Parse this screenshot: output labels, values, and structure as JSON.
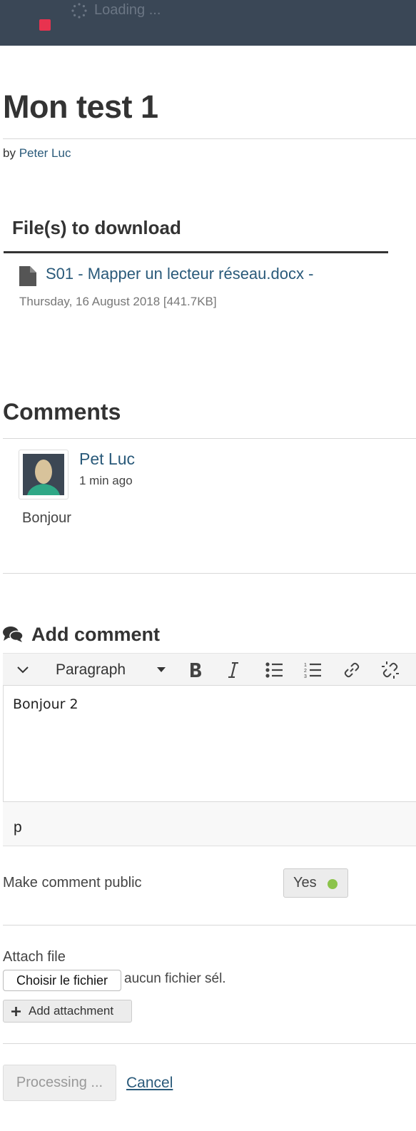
{
  "topbar": {
    "loading_text": "Loading ..."
  },
  "post": {
    "title": "Mon test 1",
    "by_prefix": "by",
    "author": "Peter Luc"
  },
  "files": {
    "section_title": "File(s) to download",
    "items": [
      {
        "name": "S01 - Mapper un lecteur réseau.docx -",
        "meta": "Thursday, 16 August 2018 [441.7KB]"
      }
    ]
  },
  "comments": {
    "section_title": "Comments",
    "items": [
      {
        "author": "Pet Luc",
        "time": "1 min ago",
        "body": "Bonjour"
      }
    ]
  },
  "add_comment": {
    "title": "Add comment",
    "toolbar": {
      "format_label": "Paragraph"
    },
    "editor_value": "Bonjour 2",
    "status_path": "p",
    "public_label": "Make comment public",
    "public_toggle_label": "Yes",
    "attach_label": "Attach file",
    "choose_file_label": "Choisir le fichier",
    "no_file_text": "aucun fichier sél.",
    "add_attachment_label": "Add attachment",
    "submit_label": "Processing ...",
    "cancel_label": "Cancel"
  },
  "colors": {
    "topbar": "#3a4756",
    "link": "#2a5a7a",
    "toggle_on": "#8bc34a"
  },
  "icons": [
    "spinner-icon",
    "file-icon",
    "comments-icon",
    "chevron-down-icon",
    "caret-down-icon",
    "bold-icon",
    "italic-icon",
    "bullet-list-icon",
    "numbered-list-icon",
    "link-icon",
    "unlink-icon",
    "plus-icon"
  ]
}
